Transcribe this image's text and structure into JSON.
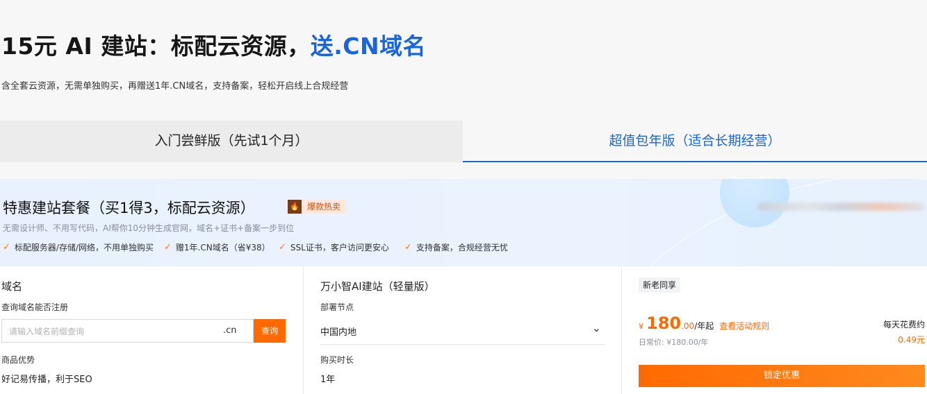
{
  "header": {
    "title_main": "15元 AI 建站：标配云资源，",
    "title_highlight": "送.CN域名",
    "subtitle": "含全套云资源，无需单独购买，再赠送1年.CN域名，支持备案，轻松开启线上合规经营"
  },
  "tabs": [
    {
      "label": "入门尝鲜版（先试1个月）",
      "active": false
    },
    {
      "label": "超值包年版（适合长期经营）",
      "active": true
    }
  ],
  "package": {
    "title": "特惠建站套餐（买1得3，标配云资源）",
    "badge_icon": "fire-icon",
    "badge": "爆款热卖",
    "description": "无需设计师、不用写代码，AI帮你10分钟生成官网，域名+证书+备案一步到位",
    "features": [
      "标配服务器/存储/网络，不用单独购买",
      "赠1年.CN域名（省¥38）",
      "SSL证书，客户访问更安心",
      "支持备案，合规经营无忧"
    ]
  },
  "domain_section": {
    "title": "域名",
    "query_label": "查询域名能否注册",
    "input_placeholder": "请输入域名前缀查询",
    "suffix": ".cn",
    "search_button": "查询",
    "advantage_label": "商品优势",
    "advantage_value": "好记易传播，利于SEO"
  },
  "site_section": {
    "title": "万小智AI建站（轻量版）",
    "region_label": "部署节点",
    "region_value": "中国内地",
    "duration_label": "购买时长",
    "duration_value": "1年"
  },
  "purchase": {
    "tag": "新老同享",
    "currency": "¥",
    "price_int": "180",
    "price_dec": ".00",
    "price_unit": "/年起",
    "rules_link": "查看活动规则",
    "original_price": "日常价: ¥180.00/年",
    "daily_label": "每天花费约",
    "daily_value": "0.49元",
    "cta": "锁定优惠"
  },
  "colors": {
    "accent_blue": "#1a66d6",
    "accent_orange": "#ff6a00"
  }
}
